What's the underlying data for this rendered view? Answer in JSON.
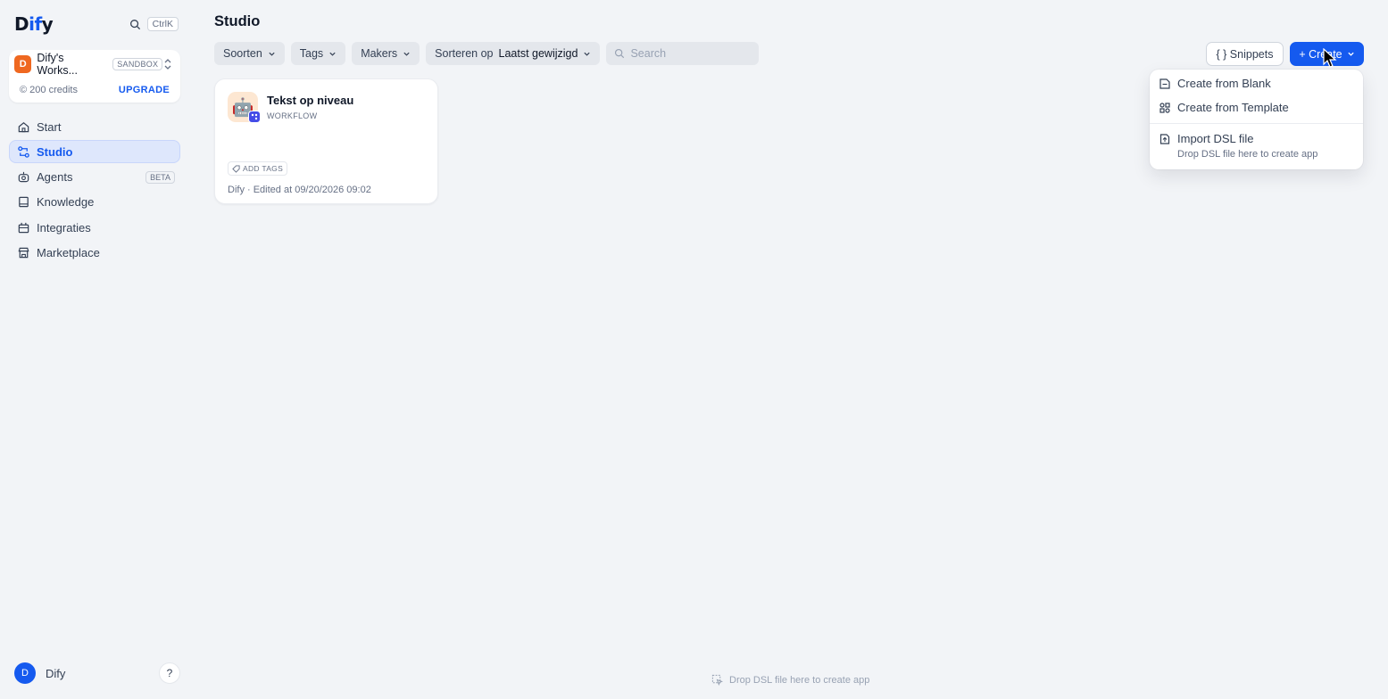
{
  "brand": {
    "logo_pre": "D",
    "logo_accent": "if",
    "logo_post": "y",
    "accent_color": "#155aef"
  },
  "shortcut": {
    "icon": "search-icon",
    "key": "CtrlK"
  },
  "workspace": {
    "avatar": "D",
    "name": "Dify's Works...",
    "badge": "SANDBOX",
    "credits": "200 credits",
    "upgrade": "UPGRADE"
  },
  "nav": {
    "items": [
      {
        "label": "Start",
        "icon": "home-icon"
      },
      {
        "label": "Studio",
        "icon": "studio-icon",
        "active": true
      },
      {
        "label": "Agents",
        "icon": "agent-icon",
        "badge": "BETA"
      },
      {
        "label": "Knowledge",
        "icon": "book-icon"
      },
      {
        "label": "Integraties",
        "icon": "integrations-icon"
      },
      {
        "label": "Marketplace",
        "icon": "store-icon"
      }
    ]
  },
  "user": {
    "avatar": "D",
    "name": "Dify",
    "help": "?"
  },
  "page": {
    "title": "Studio"
  },
  "filters": {
    "types": "Soorten",
    "tags": "Tags",
    "makers": "Makers",
    "sort_prefix": "Sorteren op",
    "sort_value": "Laatst gewijzigd",
    "search_placeholder": "Search"
  },
  "toolbar": {
    "snippets_label": "{ } Snippets",
    "create_label": "+ Create"
  },
  "create_menu": {
    "blank": "Create from Blank",
    "template": "Create from Template",
    "import": "Import DSL file",
    "import_hint": "Drop DSL file here to create app"
  },
  "apps": [
    {
      "name": "Tekst op niveau",
      "type": "WORKFLOW",
      "icon": "robot-emoji",
      "add_tags": "ADD TAGS",
      "meta": "Dify · Edited at 09/20/2026 09:02"
    }
  ],
  "drop_hint": "Drop DSL file here to create app"
}
